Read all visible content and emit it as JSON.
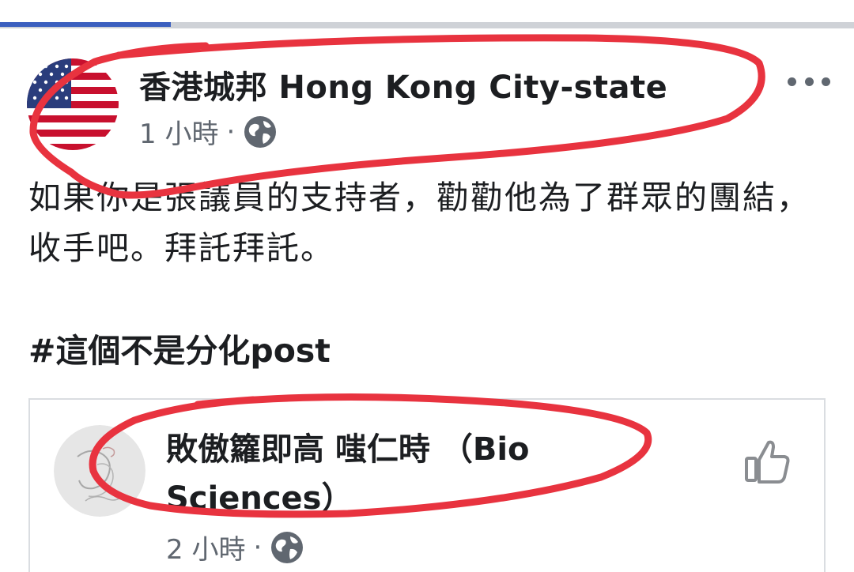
{
  "header": {
    "tab_accent_color": "#3b5fbf"
  },
  "post": {
    "author_name": "香港城邦 Hong Kong City-state",
    "avatar_icon": "us-flag-icon",
    "timestamp": "1 小時",
    "separator": "·",
    "privacy_icon": "globe-icon",
    "more_icon": "more-horizontal-icon",
    "body_text": "如果你是張議員的支持者，勸勸他為了群眾的團結，收手吧。拜託拜託。",
    "hashtag": "#這個不是分化post"
  },
  "shared_post": {
    "title": "敗傲籮即高 嗤仁時 （Bio Sciences）",
    "avatar_icon": "illustration-avatar-icon",
    "timestamp": "2 小時",
    "separator": "·",
    "privacy_icon": "globe-icon",
    "like_icon": "thumbs-up-icon"
  },
  "annotation": {
    "color": "#e8333f"
  }
}
